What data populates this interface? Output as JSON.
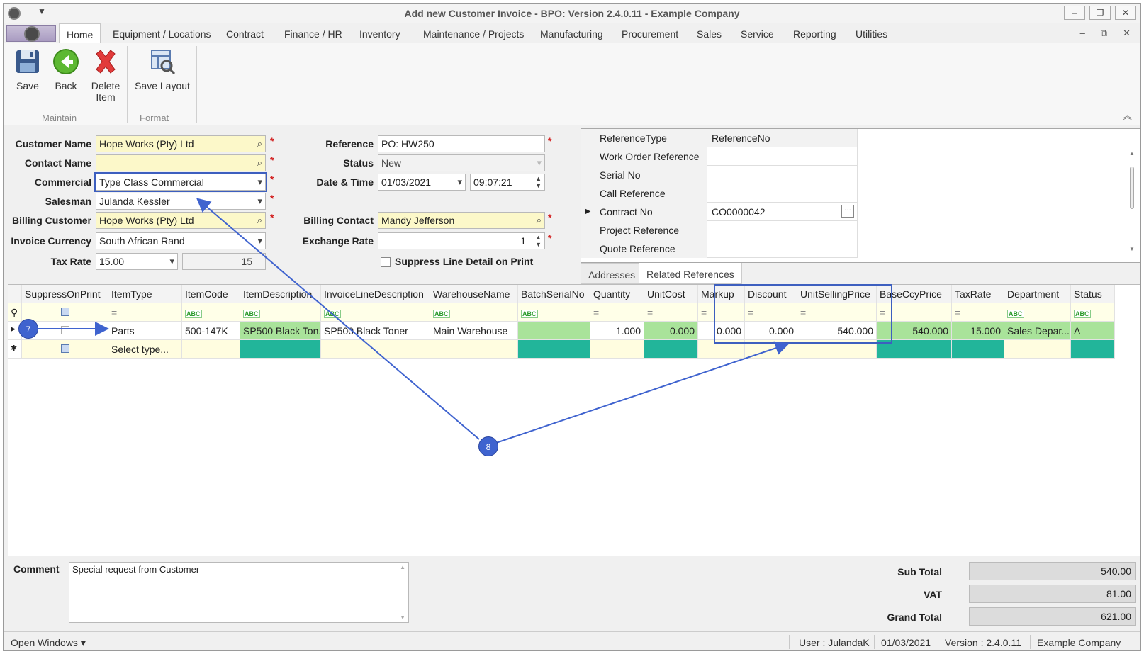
{
  "window": {
    "title": "Add new Customer Invoice - BPO: Version 2.4.0.11 - Example Company",
    "controls": [
      "–",
      "❐",
      "✕"
    ]
  },
  "menu": {
    "tabs": [
      "Home",
      "Equipment / Locations",
      "Contract",
      "Finance / HR",
      "Inventory",
      "Maintenance / Projects",
      "Manufacturing",
      "Procurement",
      "Sales",
      "Service",
      "Reporting",
      "Utilities"
    ],
    "mdi_controls": [
      "–",
      "⧉",
      "✕"
    ]
  },
  "ribbon": {
    "save": "Save",
    "back": "Back",
    "delete_line1": "Delete",
    "delete_line2": "Item",
    "save_layout": "Save Layout",
    "group_maintain": "Maintain",
    "group_format": "Format"
  },
  "form": {
    "customer_name_label": "Customer Name",
    "customer_name": "Hope Works (Pty) Ltd",
    "contact_name_label": "Contact Name",
    "contact_name": "",
    "commercial_label": "Commercial",
    "commercial": "Type Class Commercial",
    "salesman_label": "Salesman",
    "salesman": "Julanda Kessler",
    "billing_customer_label": "Billing Customer",
    "billing_customer": "Hope Works (Pty) Ltd",
    "invoice_currency_label": "Invoice Currency",
    "invoice_currency": "South African Rand",
    "tax_rate_label": "Tax Rate",
    "tax_rate": "15.00",
    "tax_rate_value": "15",
    "reference_label": "Reference",
    "reference": "PO: HW250",
    "status_label": "Status",
    "status": "New",
    "date_time_label": "Date & Time",
    "date": "01/03/2021",
    "time": "09:07:21",
    "billing_contact_label": "Billing Contact",
    "billing_contact": "Mandy Jefferson",
    "exchange_rate_label": "Exchange Rate",
    "exchange_rate": "1",
    "suppress_label": "Suppress Line Detail on Print",
    "required_mark": "*"
  },
  "references": {
    "headers": [
      "ReferenceType",
      "ReferenceNo"
    ],
    "rows": [
      {
        "type": "Work Order Reference",
        "no": ""
      },
      {
        "type": "Serial No",
        "no": ""
      },
      {
        "type": "Call Reference",
        "no": ""
      },
      {
        "type": "Contract No",
        "no": "CO0000042"
      },
      {
        "type": "Project Reference",
        "no": ""
      },
      {
        "type": "Quote Reference",
        "no": ""
      }
    ],
    "ellipsis": "···",
    "tabs": [
      "Addresses",
      "Related References"
    ]
  },
  "grid": {
    "columns": [
      "SuppressOnPrint",
      "ItemType",
      "ItemCode",
      "ItemDescription",
      "InvoiceLineDescription",
      "WarehouseName",
      "BatchSerialNo",
      "Quantity",
      "UnitCost",
      "Markup",
      "Discount",
      "UnitSellingPrice",
      "BaseCcyPrice",
      "TaxRate",
      "Department",
      "Status"
    ],
    "filter_abc": "ABC",
    "filter_eq": "=",
    "row": {
      "item_type": "Parts",
      "item_code": "500-147K",
      "item_description": "SP500 Black Ton...",
      "invoice_line_description": "SP500 Black Toner",
      "warehouse": "Main Warehouse",
      "batch_serial": "",
      "quantity": "1.000",
      "unit_cost": "0.000",
      "markup": "0.000",
      "discount": "0.000",
      "unit_selling_price": "540.000",
      "base_ccy_price": "540.000",
      "tax_rate": "15.000",
      "department": "Sales Depar...",
      "status": "A"
    },
    "new_row_placeholder": "Select type..."
  },
  "comment": {
    "label": "Comment",
    "value": "Special request from Customer"
  },
  "totals": {
    "sub_total_label": "Sub Total",
    "sub_total": "540.00",
    "vat_label": "VAT",
    "vat": "81.00",
    "grand_total_label": "Grand Total",
    "grand_total": "621.00"
  },
  "statusbar": {
    "open_windows": "Open Windows ▾",
    "user": "User : JulandaK",
    "date": "01/03/2021",
    "version": "Version : 2.4.0.11",
    "company": "Example Company"
  },
  "annotations": {
    "badge_7": "7",
    "badge_8": "8"
  },
  "colors": {
    "highlight": "#3d5fbf",
    "required_field": "#fcf8c9",
    "green_cell": "#a9e39a",
    "teal_cell": "#22b59a"
  }
}
